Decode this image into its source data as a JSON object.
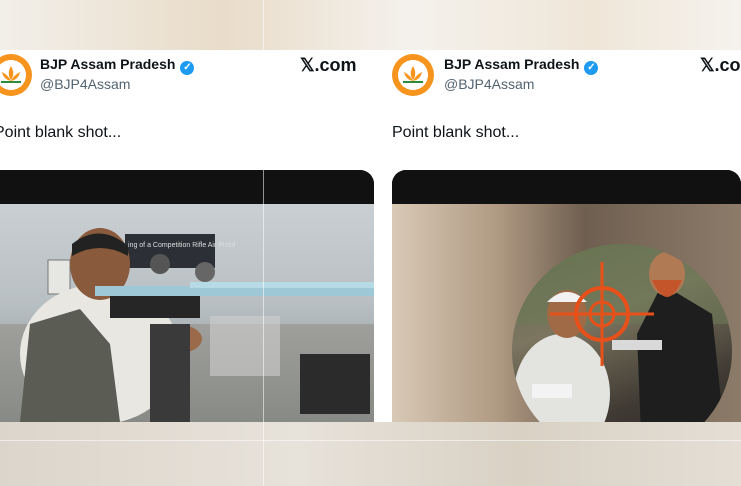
{
  "left_post": {
    "account_name": "BJP Assam Pradesh",
    "handle": "@BJP4Assam",
    "source": "𝕏.com",
    "text": "Point blank shot...",
    "image_banner_text": "ing of a Competition Rifle Air Pistol"
  },
  "right_post": {
    "account_name": "BJP Assam Pradesh",
    "handle": "@BJP4Assam",
    "source": "𝕏.com",
    "text": "Point blank shot..."
  },
  "colors": {
    "brand_saffron": "#f7941d",
    "verified_blue": "#1d9bf0",
    "reticle_orange": "#e8501a"
  },
  "icons": [
    "bjp-lotus-logo-icon",
    "verified-badge-icon",
    "x-logo-icon",
    "crosshair-icon"
  ]
}
